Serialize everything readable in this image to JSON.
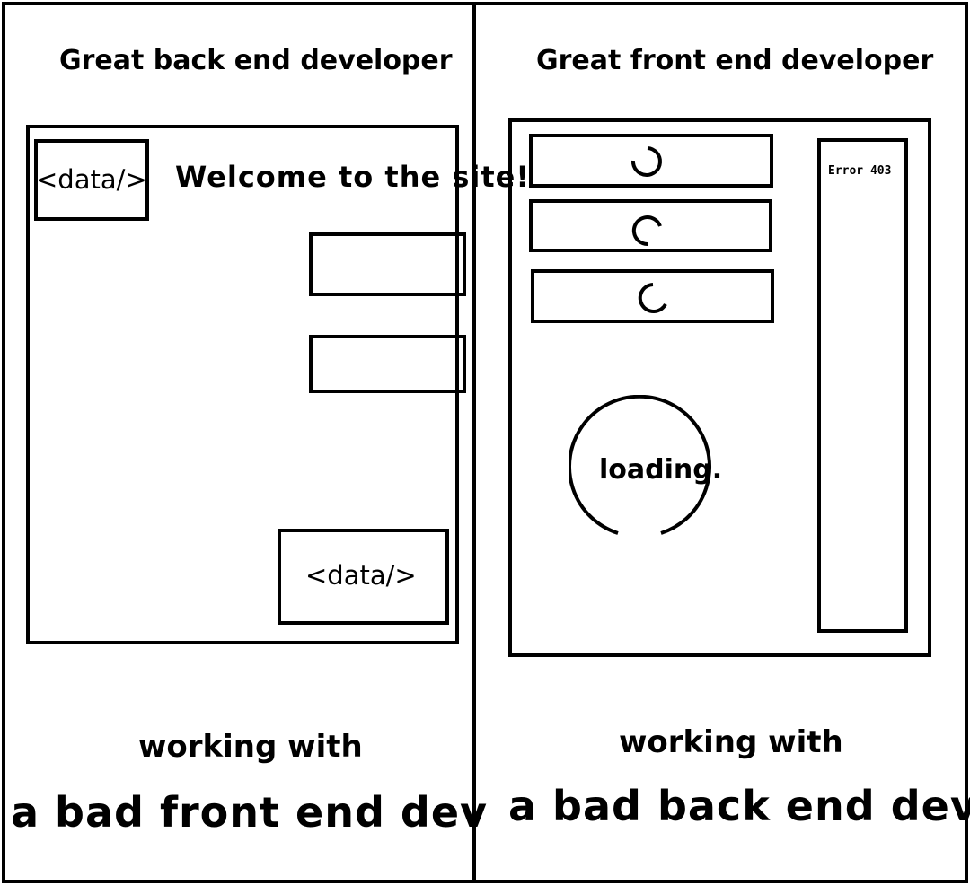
{
  "left": {
    "heading": "Great back end developer",
    "data_tag_top": "<data/>",
    "welcome": "Welcome to the site!",
    "data_tag_bottom": "<data/>",
    "caption_small": "working with",
    "caption_big": "a bad front end dev"
  },
  "right": {
    "heading": "Great front end developer",
    "error": "Error 403",
    "loading": "loading.",
    "caption_small": "working with",
    "caption_big": "a bad back end dev"
  },
  "icons": [
    "spinner-icon",
    "loading-circle-icon"
  ]
}
